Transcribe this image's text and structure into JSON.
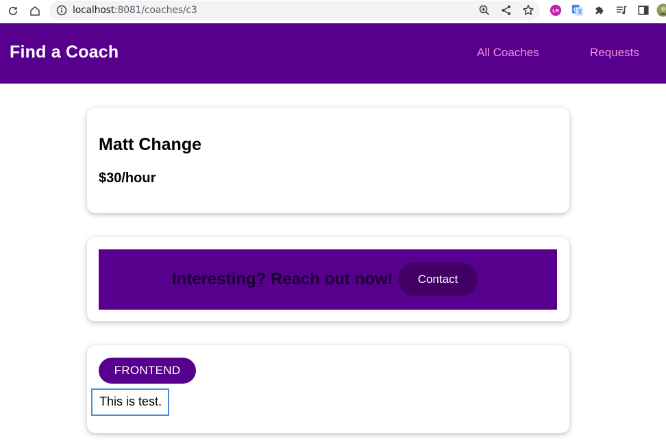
{
  "browser": {
    "url_host": "localhost",
    "url_path": ":8081/coaches/c3",
    "extension_lr_label": "LR"
  },
  "header": {
    "title": "Find a Coach",
    "nav": [
      {
        "label": "All Coaches"
      },
      {
        "label": "Requests"
      }
    ]
  },
  "coach": {
    "name": "Matt Change",
    "rate": "$30/hour"
  },
  "contact": {
    "prompt": "Interesting? Reach out now!",
    "button_label": "Contact"
  },
  "details": {
    "areas": [
      "FRONTEND"
    ],
    "description": "This is test."
  },
  "colors": {
    "header_bg": "#58008e",
    "nav_link": "#f391e3",
    "contact_button_bg": "#420066",
    "focus_outline": "#4a8fd4"
  }
}
